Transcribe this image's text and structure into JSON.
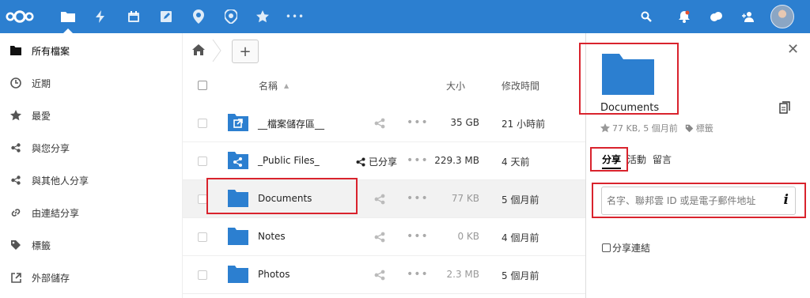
{
  "header": {
    "icons": [
      "nextcloud-logo",
      "files-icon",
      "activity-icon",
      "calendar-icon",
      "notes-icon",
      "maps-icon",
      "location-icon",
      "favorites-icon",
      "more-apps-icon"
    ],
    "right_icons": [
      "search-icon",
      "notifications-icon",
      "contacts-icon",
      "user-avatar"
    ],
    "brand_color": "#2c7fd0"
  },
  "sidebar": {
    "items": [
      {
        "label": "所有檔案",
        "icon": "folder-icon"
      },
      {
        "label": "近期",
        "icon": "clock-icon"
      },
      {
        "label": "最愛",
        "icon": "star-icon"
      },
      {
        "label": "與您分享",
        "icon": "share-icon"
      },
      {
        "label": "與其他人分享",
        "icon": "share-icon"
      },
      {
        "label": "由連結分享",
        "icon": "link-icon"
      },
      {
        "label": "標籤",
        "icon": "tag-icon"
      },
      {
        "label": "外部儲存",
        "icon": "external-icon"
      }
    ]
  },
  "files": {
    "breadcrumb_home": "home-icon",
    "add_label": "+",
    "columns": {
      "name": "名稱",
      "size": "大小",
      "modified": "修改時間"
    },
    "rows": [
      {
        "name": "__檔案儲存區__",
        "size": "35 GB",
        "modified": "21 小時前",
        "icon": "external-folder-icon",
        "shared": ""
      },
      {
        "name": "_Public Files_",
        "size": "229.3 MB",
        "modified": "4 天前",
        "icon": "shared-folder-icon",
        "shared": "已分享"
      },
      {
        "name": "Documents",
        "size": "77 KB",
        "modified": "5 個月前",
        "icon": "folder-icon",
        "shared": ""
      },
      {
        "name": "Notes",
        "size": "0 KB",
        "modified": "4 個月前",
        "icon": "folder-icon",
        "shared": ""
      },
      {
        "name": "Photos",
        "size": "2.3 MB",
        "modified": "5 個月前",
        "icon": "folder-icon",
        "shared": ""
      }
    ],
    "more_label": "•••"
  },
  "detail": {
    "title": "Documents",
    "meta": "77 KB, 5 個月前",
    "tags_label": "標籤",
    "tabs": [
      "分享",
      "活動",
      "留言"
    ],
    "share_placeholder": "名字、聯邦雲 ID 或是電子郵件地址",
    "share_link_label": "分享連結",
    "close_label": "✕"
  }
}
